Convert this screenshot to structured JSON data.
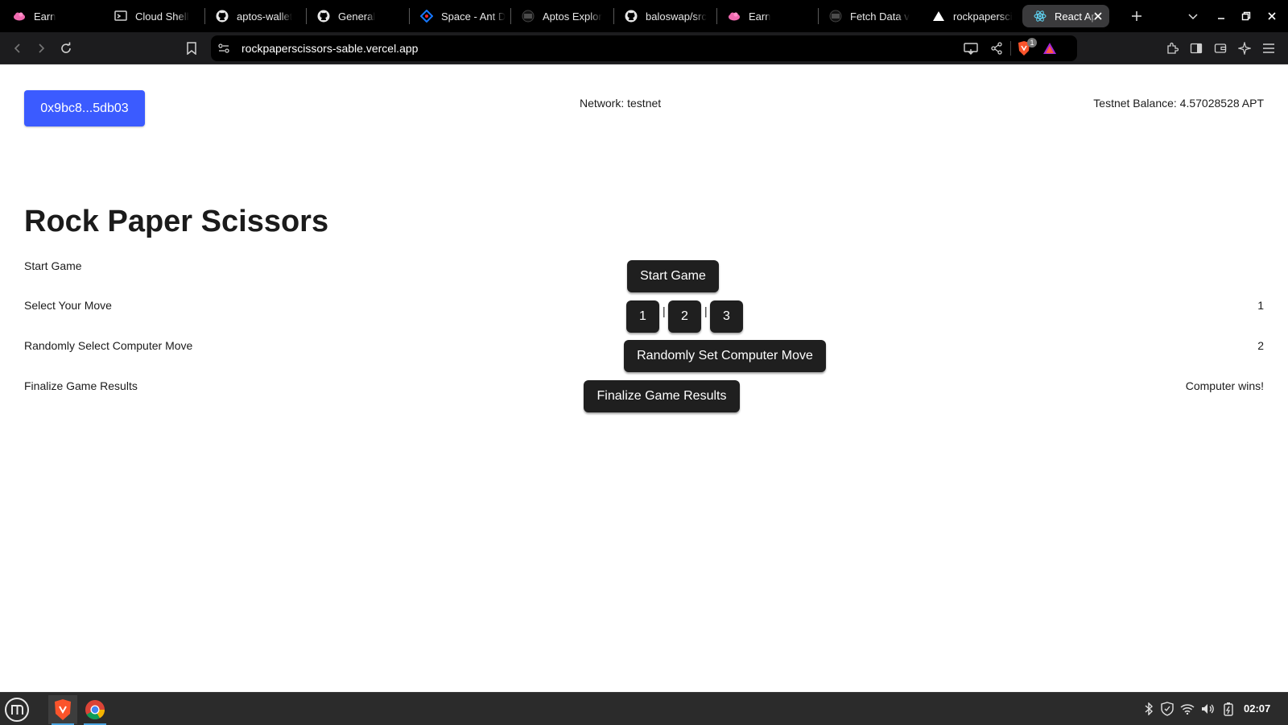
{
  "browser": {
    "tabs": [
      {
        "title": "Earn",
        "icon": "pink-cloud-icon"
      },
      {
        "title": "Cloud Shell",
        "icon": "cloud-shell-icon"
      },
      {
        "title": "aptos-wallet",
        "icon": "github-icon"
      },
      {
        "title": "General",
        "icon": "github-icon"
      },
      {
        "title": "Space - Ant D",
        "icon": "diamond-icon"
      },
      {
        "title": "Aptos Explor",
        "icon": "aptos-icon"
      },
      {
        "title": "baloswap/src",
        "icon": "github-icon"
      },
      {
        "title": "Earn",
        "icon": "pink-cloud-icon"
      },
      {
        "title": "Fetch Data v",
        "icon": "aptos-icon"
      },
      {
        "title": "rockpapersci",
        "icon": "vercel-icon"
      },
      {
        "title": "React Ap",
        "icon": "react-icon"
      }
    ],
    "active_tab": "React Ap",
    "url": "rockpaperscissors-sable.vercel.app",
    "brave_badge": "1"
  },
  "header": {
    "wallet_button": "0x9bc8...5db03",
    "network": "Network: testnet",
    "balance": "Testnet Balance: 4.57028528 APT"
  },
  "main": {
    "title": "Rock Paper Scissors",
    "rows": {
      "start": {
        "label": "Start Game",
        "button": "Start Game",
        "value": ""
      },
      "move": {
        "label": "Select Your Move",
        "options": [
          "1",
          "2",
          "3"
        ],
        "separator": "|",
        "value": "1"
      },
      "computer": {
        "label": "Randomly Select Computer Move",
        "button": "Randomly Set Computer Move",
        "value": "2"
      },
      "finalize": {
        "label": "Finalize Game Results",
        "button": "Finalize Game Results",
        "value": "Computer wins!"
      }
    }
  },
  "taskbar": {
    "clock": "02:07",
    "apps": [
      "menu-icon",
      "brave-icon",
      "chrome-icon"
    ]
  },
  "colors": {
    "wallet_button": "#3b5bff",
    "dark_button": "#1f1f1f",
    "tab_bar": "#000000",
    "toolbar": "#1c1c1e",
    "taskbar": "#2b2b2b"
  }
}
